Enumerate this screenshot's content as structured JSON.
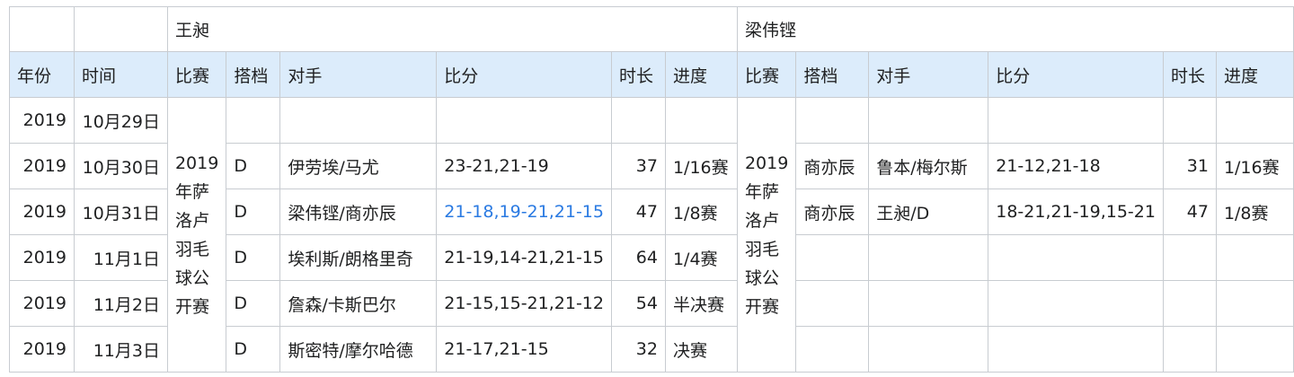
{
  "players": [
    "王昶",
    "梁伟铿"
  ],
  "headers": {
    "year": "年份",
    "time": "时间",
    "match": "比赛",
    "partner": "搭档",
    "opponent": "对手",
    "score": "比分",
    "duration": "时长",
    "progress": "进度"
  },
  "event": {
    "line1": "2019",
    "line2": "年萨",
    "line3": "洛卢",
    "line4": "羽毛",
    "line5": "球公",
    "line6": "开赛"
  },
  "rows": [
    {
      "year": "2019",
      "date": "10月29日",
      "p1": {
        "partner": "",
        "opponent": "",
        "score": "",
        "duration": "",
        "progress": ""
      },
      "p2": {
        "partner": "",
        "opponent": "",
        "score": "",
        "duration": "",
        "progress": ""
      }
    },
    {
      "year": "2019",
      "date": "10月30日",
      "p1": {
        "partner": "D",
        "opponent": "伊劳埃/马尤",
        "score": "23-21,21-19",
        "duration": "37",
        "progress": "1/16赛"
      },
      "p2": {
        "partner": "商亦辰",
        "opponent": "鲁本/梅尔斯",
        "score": "21-12,21-18",
        "duration": "31",
        "progress": "1/16赛"
      }
    },
    {
      "year": "2019",
      "date": "10月31日",
      "p1": {
        "partner": "D",
        "opponent": "梁伟铿/商亦辰",
        "score": "21-18,19-21,21-15",
        "duration": "47",
        "progress": "1/8赛"
      },
      "p2": {
        "partner": "商亦辰",
        "opponent": "王昶/D",
        "score": "18-21,21-19,15-21",
        "duration": "47",
        "progress": "1/8赛"
      }
    },
    {
      "year": "2019",
      "date": "11月1日",
      "p1": {
        "partner": "D",
        "opponent": "埃利斯/朗格里奇",
        "score": "21-19,14-21,21-15",
        "duration": "64",
        "progress": "1/4赛"
      },
      "p2": {
        "partner": "",
        "opponent": "",
        "score": "",
        "duration": "",
        "progress": ""
      }
    },
    {
      "year": "2019",
      "date": "11月2日",
      "p1": {
        "partner": "D",
        "opponent": "詹森/卡斯巴尔",
        "score": "21-15,15-21,21-12",
        "duration": "54",
        "progress": "半决赛"
      },
      "p2": {
        "partner": "",
        "opponent": "",
        "score": "",
        "duration": "",
        "progress": ""
      }
    },
    {
      "year": "2019",
      "date": "11月3日",
      "p1": {
        "partner": "D",
        "opponent": "斯密特/摩尔哈德",
        "score": "21-17,21-15",
        "duration": "32",
        "progress": "决赛"
      },
      "p2": {
        "partner": "",
        "opponent": "",
        "score": "",
        "duration": "",
        "progress": ""
      }
    }
  ],
  "colors": {
    "header_bg": "#dcecfb",
    "border": "#c8ccd1",
    "link": "#2a7ae2",
    "text": "#202122"
  }
}
